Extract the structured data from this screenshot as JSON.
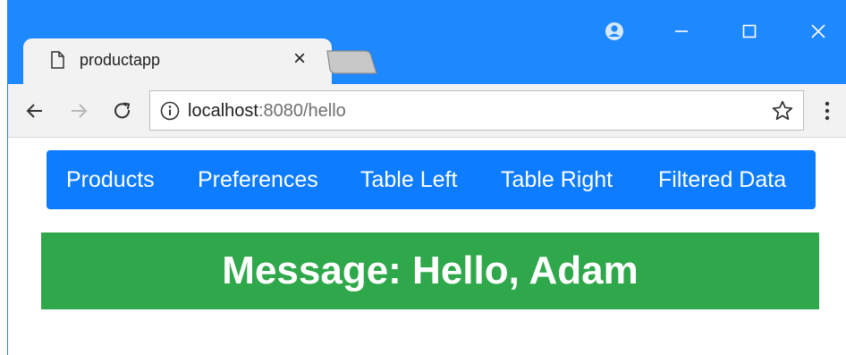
{
  "browser": {
    "tab": {
      "title": "productapp",
      "close_glyph": "×",
      "page_icon": "page-icon"
    },
    "address": {
      "host": "localhost",
      "rest": ":8080/hello",
      "info_icon": "info-icon",
      "bookmark_icon": "star-icon"
    },
    "toolbar_icons": [
      "back-arrow-icon",
      "forward-arrow-icon",
      "reload-icon",
      "menu-dots-icon"
    ],
    "window_icons": [
      "account-icon",
      "minimize-icon",
      "maximize-icon",
      "close-icon"
    ]
  },
  "nav": {
    "items": [
      {
        "label": "Products"
      },
      {
        "label": "Preferences"
      },
      {
        "label": "Table Left"
      },
      {
        "label": "Table Right"
      },
      {
        "label": "Filtered Data"
      }
    ]
  },
  "message": {
    "text": "Message: Hello, Adam"
  },
  "colors": {
    "titlebar": "#1e88ff",
    "nav_bar": "#0d7cff",
    "message_bg": "#2ea84a",
    "text_light": "#ffffff"
  }
}
